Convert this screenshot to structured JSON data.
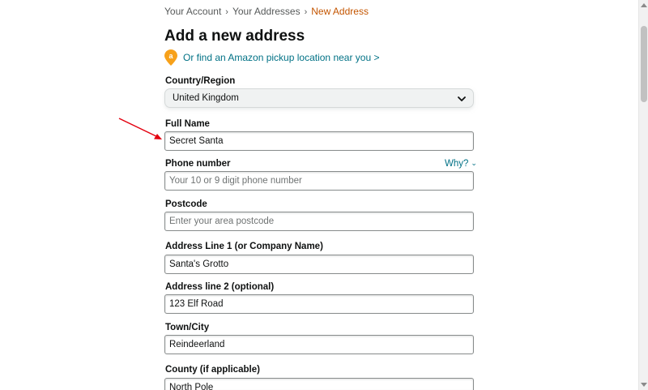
{
  "breadcrumb": {
    "items": [
      "Your Account",
      "Your Addresses",
      "New Address"
    ],
    "separator": "›"
  },
  "page": {
    "title": "Add a new address",
    "pickup_link": "Or find an Amazon pickup location near you >",
    "pickup_icon": "amazon-location-pin-icon"
  },
  "form": {
    "country": {
      "label": "Country/Region",
      "value": "United Kingdom"
    },
    "full_name": {
      "label": "Full Name",
      "value": "Secret Santa"
    },
    "phone": {
      "label": "Phone number",
      "placeholder": "Your 10 or 9 digit phone number",
      "why": "Why?"
    },
    "postcode": {
      "label": "Postcode",
      "placeholder": "Enter your area postcode"
    },
    "address1": {
      "label": "Address Line 1 (or Company Name)",
      "value": "Santa's Grotto"
    },
    "address2": {
      "label": "Address line 2 (optional)",
      "value": "123 Elf Road"
    },
    "town": {
      "label": "Town/City",
      "value": "Reindeerland"
    },
    "county": {
      "label": "County (if applicable)",
      "value": "North Pole"
    }
  },
  "annotation": {
    "color": "#e3000f",
    "icon": "red-arrow-icon"
  },
  "colors": {
    "link": "#007185",
    "breadcrumb_current": "#c45500",
    "pin": "#f7a11a"
  }
}
